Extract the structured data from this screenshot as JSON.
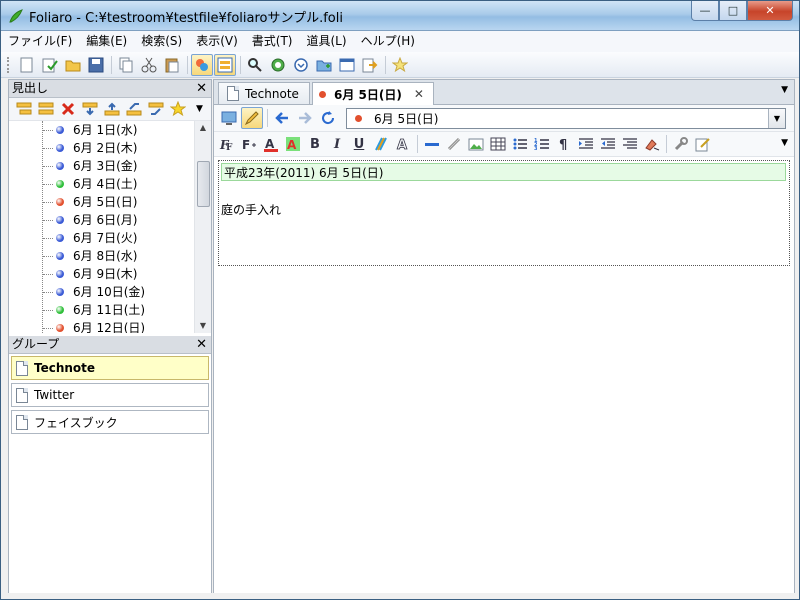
{
  "window": {
    "title": "Foliaro - C:¥testroom¥testfile¥foliaroサンプル.foli",
    "min_label": "—",
    "max_label": "□",
    "close_label": "✕"
  },
  "menu": [
    "ファイル(F)",
    "編集(E)",
    "検索(S)",
    "表示(V)",
    "書式(T)",
    "道具(L)",
    "ヘルプ(H)"
  ],
  "outline": {
    "header": "見出し",
    "close": "✕",
    "items": [
      {
        "label": "6月 1日(水)",
        "color": "#3b5bd6"
      },
      {
        "label": "6月 2日(木)",
        "color": "#3b5bd6"
      },
      {
        "label": "6月 3日(金)",
        "color": "#3b5bd6"
      },
      {
        "label": "6月 4日(土)",
        "color": "#2fbf3a"
      },
      {
        "label": "6月 5日(日)",
        "color": "#e2502e"
      },
      {
        "label": "6月 6日(月)",
        "color": "#3b5bd6"
      },
      {
        "label": "6月 7日(火)",
        "color": "#3b5bd6"
      },
      {
        "label": "6月 8日(水)",
        "color": "#3b5bd6"
      },
      {
        "label": "6月 9日(木)",
        "color": "#3b5bd6"
      },
      {
        "label": "6月 10日(金)",
        "color": "#3b5bd6"
      },
      {
        "label": "6月 11日(土)",
        "color": "#2fbf3a"
      },
      {
        "label": "6月 12日(日)",
        "color": "#e2502e"
      }
    ]
  },
  "groups": {
    "header": "グループ",
    "close": "✕",
    "items": [
      "Technote",
      "Twitter",
      "フェイスブック"
    ]
  },
  "tabs": {
    "items": [
      "Technote",
      "6月 5日(日)"
    ],
    "active_dot_color": "#e2502e",
    "close": "✕",
    "dropdown": "▼"
  },
  "nav": {
    "title_value": "6月 5日(日)",
    "dot_color": "#e2502e",
    "combo_arrow": "▼"
  },
  "format": {
    "bold": "B",
    "italic": "I",
    "underline": "U",
    "dropdown": "▼"
  },
  "editor": {
    "date_line": "平成23年(2011) 6月 5日(日)",
    "body": "庭の手入れ"
  },
  "scroll": {
    "up": "▲",
    "down": "▼"
  }
}
